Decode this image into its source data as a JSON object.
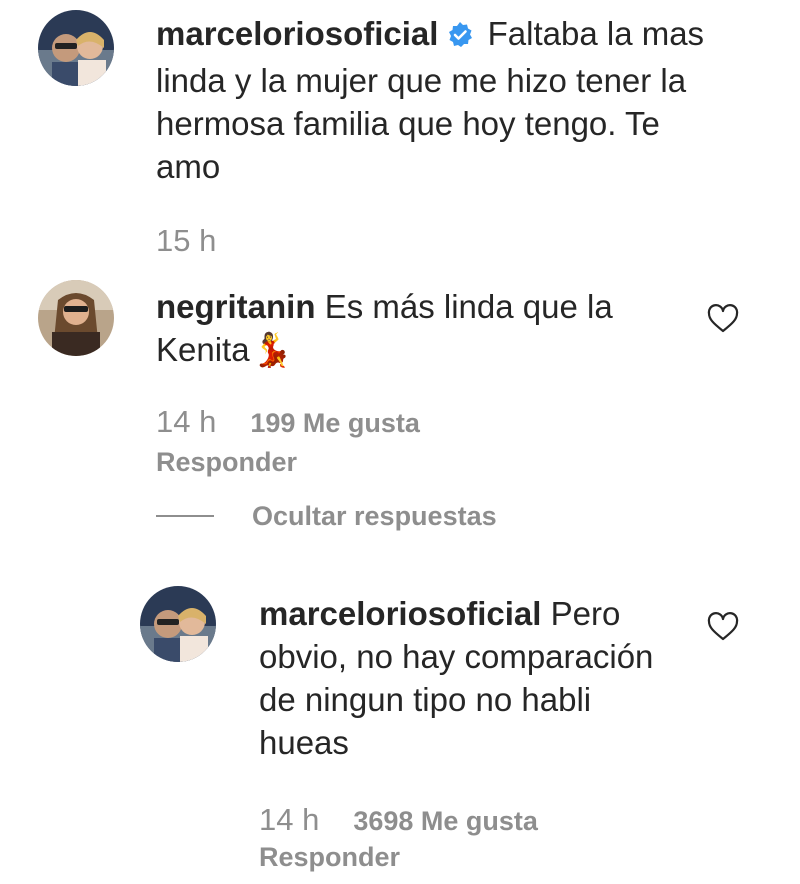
{
  "comments": [
    {
      "username": "marceloriosoficial",
      "text": "Faltaba la mas linda y la mujer que me hizo tener la hermosa familia que hoy tengo. Te amo",
      "time": "15 h"
    },
    {
      "username": "negritanin",
      "text": "Es más linda que la Kenita",
      "emoji": "💃",
      "time": "14 h",
      "likes": "199 Me gusta",
      "reply_label": "Responder"
    }
  ],
  "thread": {
    "toggle_label": "Ocultar respuestas"
  },
  "reply": {
    "username": "marceloriosoficial",
    "text": "Pero obvio, no hay comparación de ningun tipo no habli hueas",
    "time": "14 h",
    "likes": "3698 Me gusta",
    "reply_label": "Responder"
  },
  "colors": {
    "text": "#262626",
    "secondary": "#8e8e8e",
    "verified": "#3897f0"
  },
  "icons": {
    "verified": "verified-badge-icon",
    "like": "heart-outline-icon"
  }
}
